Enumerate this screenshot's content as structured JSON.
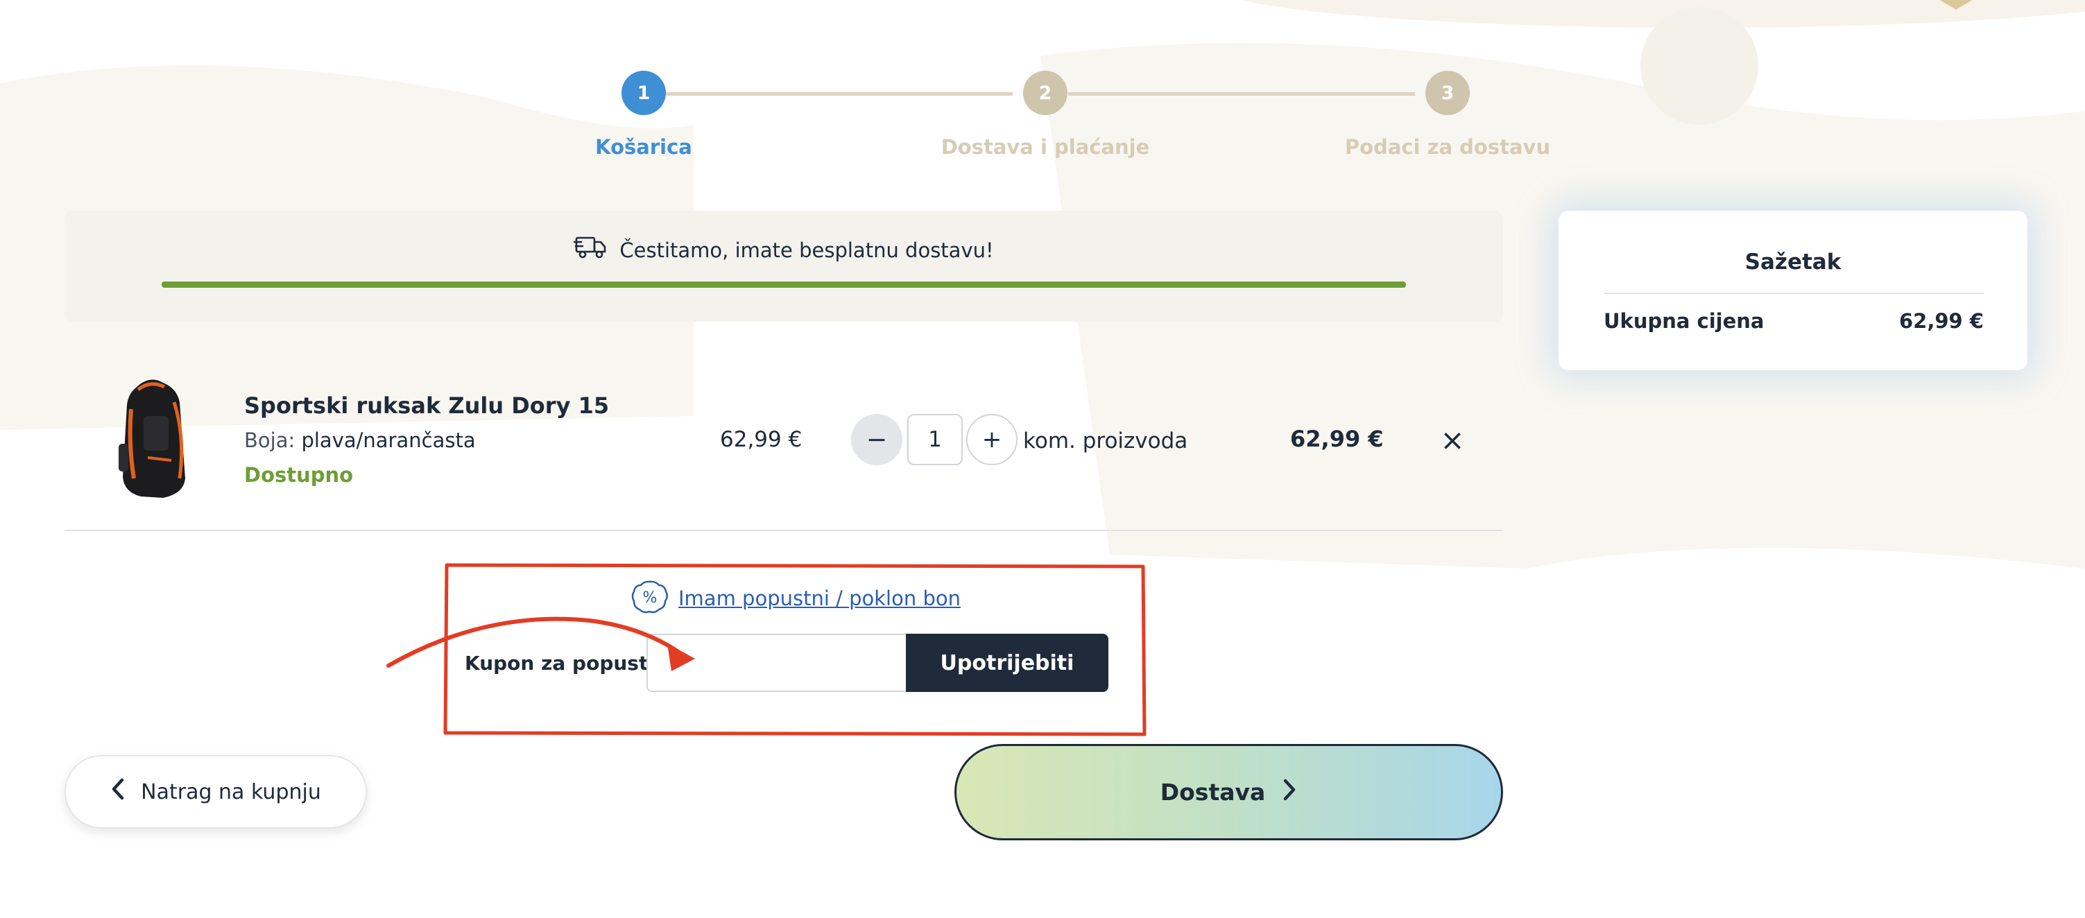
{
  "stepper": {
    "steps": [
      {
        "number": "1",
        "label": "Košarica",
        "state": "active"
      },
      {
        "number": "2",
        "label": "Dostava i plaćanje",
        "state": "inactive"
      },
      {
        "number": "3",
        "label": "Podaci za dostavu",
        "state": "inactive"
      }
    ]
  },
  "shipping_banner": {
    "icon": "truck-icon",
    "text": "Čestitamo, imate besplatnu dostavu!",
    "progress_percent": 100
  },
  "cart": {
    "item": {
      "name": "Sportski ruksak Zulu Dory 15",
      "color_label": "Boja:",
      "color_value": "plava/narančasta",
      "availability": "Dostupno",
      "unit_price": "62,99 €",
      "quantity": "1",
      "quantity_unit": "kom. proizvoda",
      "total": "62,99 €",
      "minus_label": "−",
      "plus_label": "+",
      "remove_label": "×"
    }
  },
  "coupon": {
    "link_text": "Imam popustni / poklon bon",
    "icon_glyph": "%",
    "label": "Kupon za popust",
    "label_suffix": ":",
    "input_value": "",
    "apply_label": "Upotrijebiti"
  },
  "navigation": {
    "back_label": "Natrag na kupnju",
    "next_label": "Dostava"
  },
  "summary": {
    "title": "Sažetak",
    "total_label": "Ukupna cijena",
    "total_value": "62,99 €"
  },
  "colors": {
    "active_step": "#3f8fd4",
    "inactive_step": "#cfc4ac",
    "available_green": "#6e9e34",
    "dark": "#1f2a3a",
    "annotation_red": "#e23d24"
  }
}
